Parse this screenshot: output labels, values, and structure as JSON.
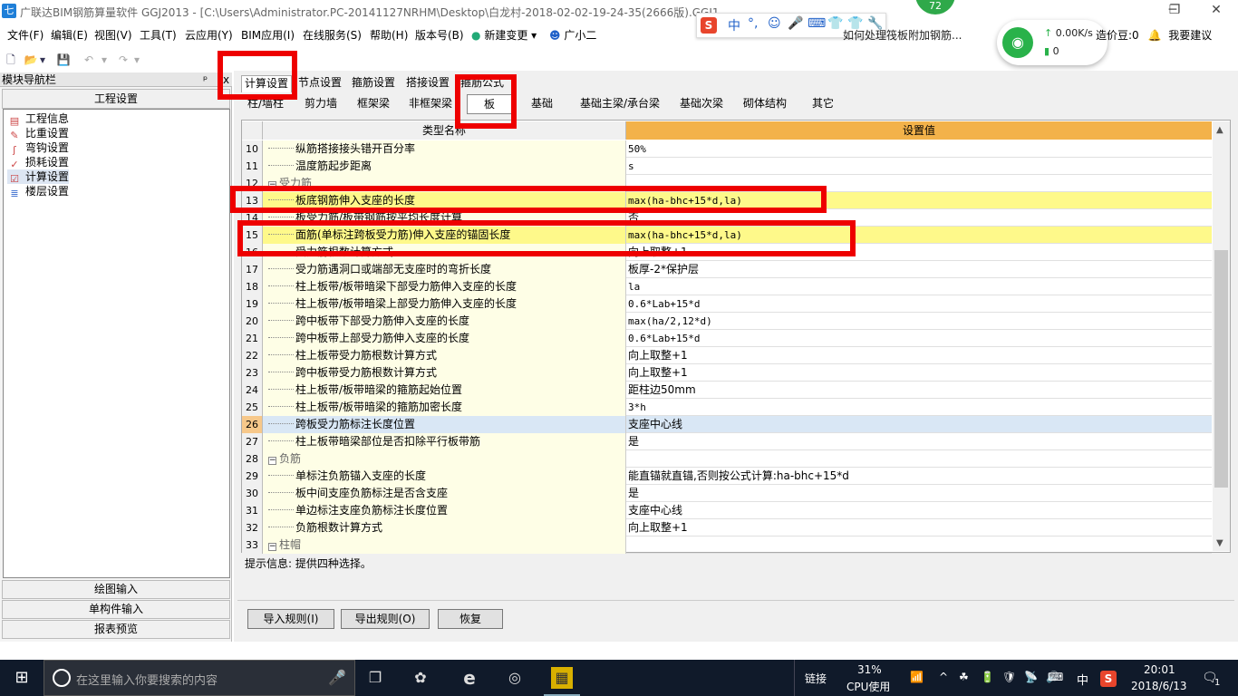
{
  "titlebar": {
    "app_glyph": "七",
    "title": "广联达BIM钢筋算量软件 GGJ2013 - [C:\\Users\\Administrator.PC-20141127NRHM\\Desktop\\白龙村-2018-02-02-19-24-35(2666版).GGJ12]",
    "minimize": "─",
    "maximize": "❐",
    "close": "✕"
  },
  "ime": {
    "logo": "S",
    "items": [
      "中",
      "°,",
      "☺",
      "🎤",
      "⌨",
      "👕",
      "👕",
      "🔧"
    ]
  },
  "badge": "72",
  "net_popup": {
    "up": "↑",
    "speed": "0.00K/s",
    "mem": "0"
  },
  "news": "如何处理筏板附加钢筋...",
  "right_items": {
    "bean": "造价豆:0",
    "suggest": "我要建议"
  },
  "menu": [
    "文件(F)",
    "编辑(E)",
    "视图(V)",
    "工具(T)",
    "云应用(Y)",
    "BIM应用(I)",
    "在线服务(S)",
    "帮助(H)",
    "版本号(B)",
    "新建变更",
    "广小二"
  ],
  "toolbar": {
    "new": "🗋",
    "open": "📂",
    "save": "💾",
    "undo": "↶",
    "redo": "↷",
    "dropdown": "▾"
  },
  "nav": {
    "header": "模块导航栏",
    "pin": "ᵖ",
    "close": "x",
    "section": "工程设置",
    "items": [
      {
        "label": "工程信息",
        "glyph": "▤"
      },
      {
        "label": "比重设置",
        "glyph": "✎"
      },
      {
        "label": "弯钩设置",
        "glyph": "ʃ"
      },
      {
        "label": "损耗设置",
        "glyph": "✓"
      },
      {
        "label": "计算设置",
        "glyph": "☑"
      },
      {
        "label": "楼层设置",
        "glyph": "≣"
      }
    ],
    "bottom": [
      "绘图输入",
      "单构件输入",
      "报表预览"
    ]
  },
  "tabs1": [
    "计算设置",
    "节点设置",
    "箍筋设置",
    "搭接设置",
    "箍筋公式"
  ],
  "tabs2": [
    "柱/墙柱",
    "剪力墙",
    "框架梁",
    "非框架梁",
    "板",
    "基础",
    "基础主梁/承台梁",
    "基础次梁",
    "砌体结构",
    "其它"
  ],
  "grid": {
    "col_name": "类型名称",
    "col_value": "设置值",
    "group_toggle": "−",
    "rows": [
      {
        "no": "10",
        "name": "纵筋搭接接头错开百分率",
        "value": "50%"
      },
      {
        "no": "11",
        "name": "温度筋起步距离",
        "value": "s"
      },
      {
        "no": "12",
        "name": "受力筋",
        "value": "",
        "group": true
      },
      {
        "no": "13",
        "name": "板底钢筋伸入支座的长度",
        "value": "max(ha-bhc+15*d,la)",
        "hl": true
      },
      {
        "no": "14",
        "name": "板受力筋/板带钢筋按平均长度计算",
        "value": "否"
      },
      {
        "no": "15",
        "name": "面筋(单标注跨板受力筋)伸入支座的锚固长度",
        "value": "max(ha-bhc+15*d,la)",
        "hl": true
      },
      {
        "no": "16",
        "name": "受力筋根数计算方式",
        "value": "向上取整+1"
      },
      {
        "no": "17",
        "name": "受力筋遇洞口或端部无支座时的弯折长度",
        "value": "板厚-2*保护层"
      },
      {
        "no": "18",
        "name": "柱上板带/板带暗梁下部受力筋伸入支座的长度",
        "value": "la"
      },
      {
        "no": "19",
        "name": "柱上板带/板带暗梁上部受力筋伸入支座的长度",
        "value": "0.6*Lab+15*d"
      },
      {
        "no": "20",
        "name": "跨中板带下部受力筋伸入支座的长度",
        "value": "max(ha/2,12*d)"
      },
      {
        "no": "21",
        "name": "跨中板带上部受力筋伸入支座的长度",
        "value": "0.6*Lab+15*d"
      },
      {
        "no": "22",
        "name": "柱上板带受力筋根数计算方式",
        "value": "向上取整+1"
      },
      {
        "no": "23",
        "name": "跨中板带受力筋根数计算方式",
        "value": "向上取整+1"
      },
      {
        "no": "24",
        "name": "柱上板带/板带暗梁的箍筋起始位置",
        "value": "距柱边50mm"
      },
      {
        "no": "25",
        "name": "柱上板带/板带暗梁的箍筋加密长度",
        "value": "3*h"
      },
      {
        "no": "26",
        "name": "跨板受力筋标注长度位置",
        "value": "支座中心线",
        "sel": true
      },
      {
        "no": "27",
        "name": "柱上板带暗梁部位是否扣除平行板带筋",
        "value": "是"
      },
      {
        "no": "28",
        "name": "负筋",
        "value": "",
        "group": true
      },
      {
        "no": "29",
        "name": "单标注负筋锚入支座的长度",
        "value": "能直锚就直锚,否则按公式计算:ha-bhc+15*d"
      },
      {
        "no": "30",
        "name": "板中间支座负筋标注是否含支座",
        "value": "是"
      },
      {
        "no": "31",
        "name": "单边标注支座负筋标注长度位置",
        "value": "支座中心线"
      },
      {
        "no": "32",
        "name": "负筋根数计算方式",
        "value": "向上取整+1"
      },
      {
        "no": "33",
        "name": "柱帽",
        "value": "",
        "group": true
      }
    ]
  },
  "hint": "提示信息: 提供四种选择。",
  "buttons": [
    "导入规则(I)",
    "导出规则(O)",
    "恢复"
  ],
  "taskbar": {
    "start": "⊞",
    "search_placeholder": "在这里输入你要搜索的内容",
    "mic": "🎤",
    "apps": [
      "❐",
      "✿",
      "e",
      "◎",
      "▦"
    ],
    "link": "链接",
    "cpu_pct": "31%",
    "cpu_label": "CPU使用",
    "ime": "中",
    "sogou": "S",
    "time": "20:01",
    "date": "2018/6/13",
    "notify": "🗨",
    "notify_count": "1",
    "tray_icons": [
      "📶",
      "^",
      "☘",
      "🔋",
      "🛡",
      "📡",
      "🔊",
      "⌨"
    ]
  },
  "colors": {
    "highlight_row": "#fef98a",
    "selected_row": "#d9e7f5",
    "header_value": "#f3b24a",
    "annotation": "#ee0000"
  }
}
